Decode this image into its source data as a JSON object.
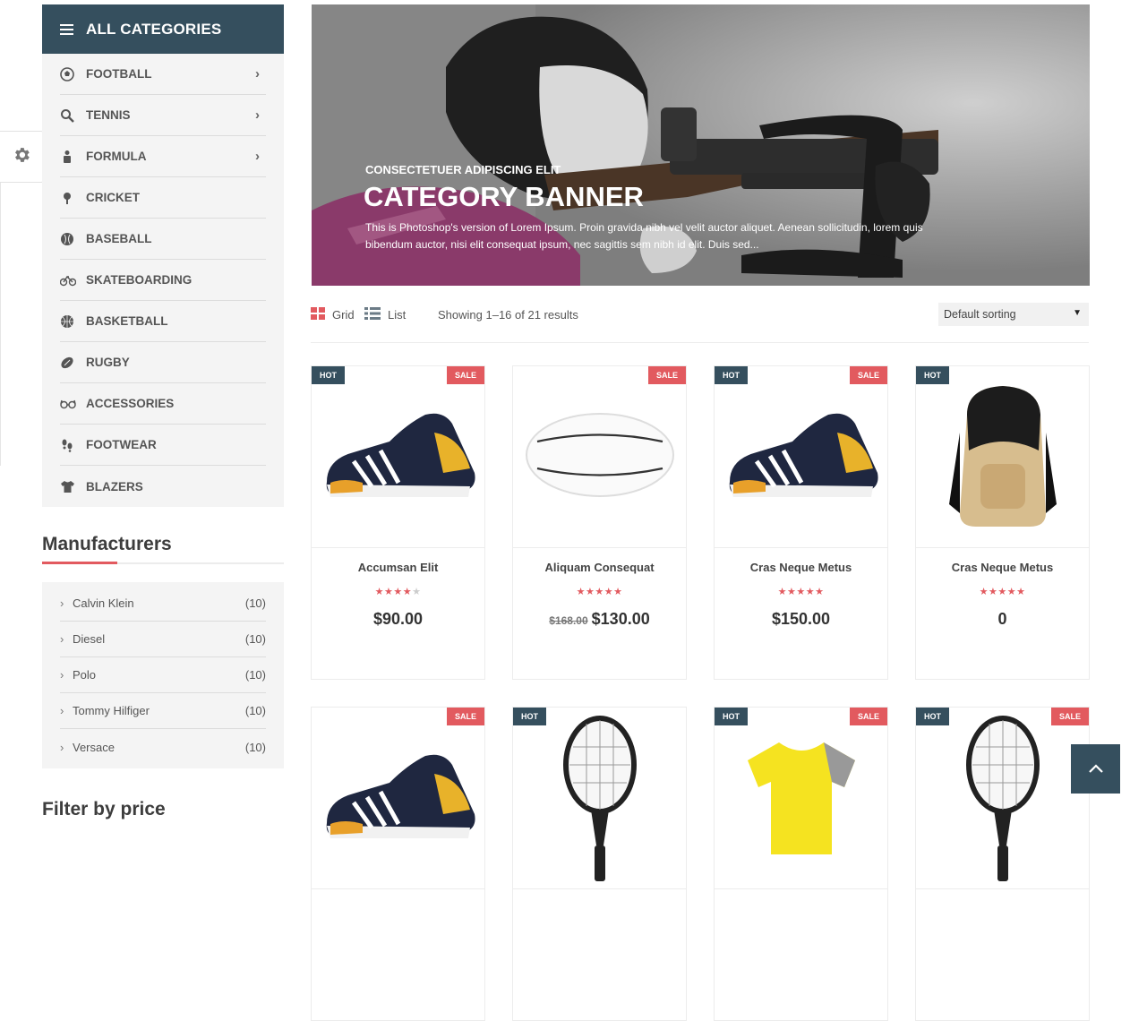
{
  "sidebar": {
    "categories_title": "ALL CATEGORIES",
    "categories": [
      {
        "label": "FOOTBALL",
        "icon": "football-icon",
        "has_sub": true
      },
      {
        "label": "TENNIS",
        "icon": "tennis-icon",
        "has_sub": true
      },
      {
        "label": "FORMULA",
        "icon": "formula-icon",
        "has_sub": true
      },
      {
        "label": "CRICKET",
        "icon": "cricket-icon",
        "has_sub": false
      },
      {
        "label": "BASEBALL",
        "icon": "baseball-icon",
        "has_sub": false
      },
      {
        "label": "SKATEBOARDING",
        "icon": "bicycle-icon",
        "has_sub": false
      },
      {
        "label": "BASKETBALL",
        "icon": "basketball-icon",
        "has_sub": false
      },
      {
        "label": "RUGBY",
        "icon": "rugby-icon",
        "has_sub": false
      },
      {
        "label": "ACCESSORIES",
        "icon": "glasses-icon",
        "has_sub": false
      },
      {
        "label": "FOOTWEAR",
        "icon": "footprint-icon",
        "has_sub": false
      },
      {
        "label": "BLAZERS",
        "icon": "shirt-icon",
        "has_sub": false
      }
    ],
    "manufacturers_title": "Manufacturers",
    "manufacturers": [
      {
        "name": "Calvin Klein",
        "count": "(10)"
      },
      {
        "name": "Diesel",
        "count": "(10)"
      },
      {
        "name": "Polo",
        "count": "(10)"
      },
      {
        "name": "Tommy Hilfiger",
        "count": "(10)"
      },
      {
        "name": "Versace",
        "count": "(10)"
      }
    ],
    "filter_title": "Filter by price"
  },
  "banner": {
    "subtitle": "CONSECTETUER ADIPISCING ELIT",
    "title": "CATEGORY BANNER",
    "description": "This is Photoshop's version  of Lorem Ipsum. Proin gravida nibh vel velit auctor aliquet. Aenean sollicitudin, lorem quis bibendum auctor, nisi elit consequat ipsum, nec sagittis sem nibh id elit. Duis sed..."
  },
  "toolbar": {
    "grid_label": "Grid",
    "list_label": "List",
    "showing": "Showing 1–16 of 21 results",
    "sort_value": "Default sorting"
  },
  "products": [
    {
      "name": "Accumsan Elit",
      "rating": 4,
      "old_price": "",
      "price": "$90.00",
      "hot": "HOT",
      "sale": "SALE",
      "image": "sneaker-icon"
    },
    {
      "name": "Aliquam Consequat",
      "rating": 5,
      "old_price": "$168.00",
      "price": "$130.00",
      "hot": "",
      "sale": "SALE",
      "image": "rugby-ball-icon"
    },
    {
      "name": "Cras Neque Metus",
      "rating": 5,
      "old_price": "",
      "price": "$150.00",
      "hot": "HOT",
      "sale": "SALE",
      "image": "sneaker-icon"
    },
    {
      "name": "Cras Neque Metus",
      "rating": 5,
      "old_price": "",
      "price": "0",
      "hot": "HOT",
      "sale": "",
      "image": "backpack-icon"
    },
    {
      "name": "",
      "rating": 0,
      "old_price": "",
      "price": "",
      "hot": "",
      "sale": "SALE",
      "image": "sneaker-icon"
    },
    {
      "name": "",
      "rating": 0,
      "old_price": "",
      "price": "",
      "hot": "HOT",
      "sale": "",
      "image": "racket-icon"
    },
    {
      "name": "",
      "rating": 0,
      "old_price": "",
      "price": "",
      "hot": "HOT",
      "sale": "SALE",
      "image": "tshirt-icon"
    },
    {
      "name": "",
      "rating": 0,
      "old_price": "",
      "price": "",
      "hot": "HOT",
      "sale": "SALE",
      "image": "racket-icon"
    }
  ],
  "colors": {
    "primary": "#354f5e",
    "accent": "#e25a5f",
    "sidebar_bg": "#f4f4f4"
  }
}
